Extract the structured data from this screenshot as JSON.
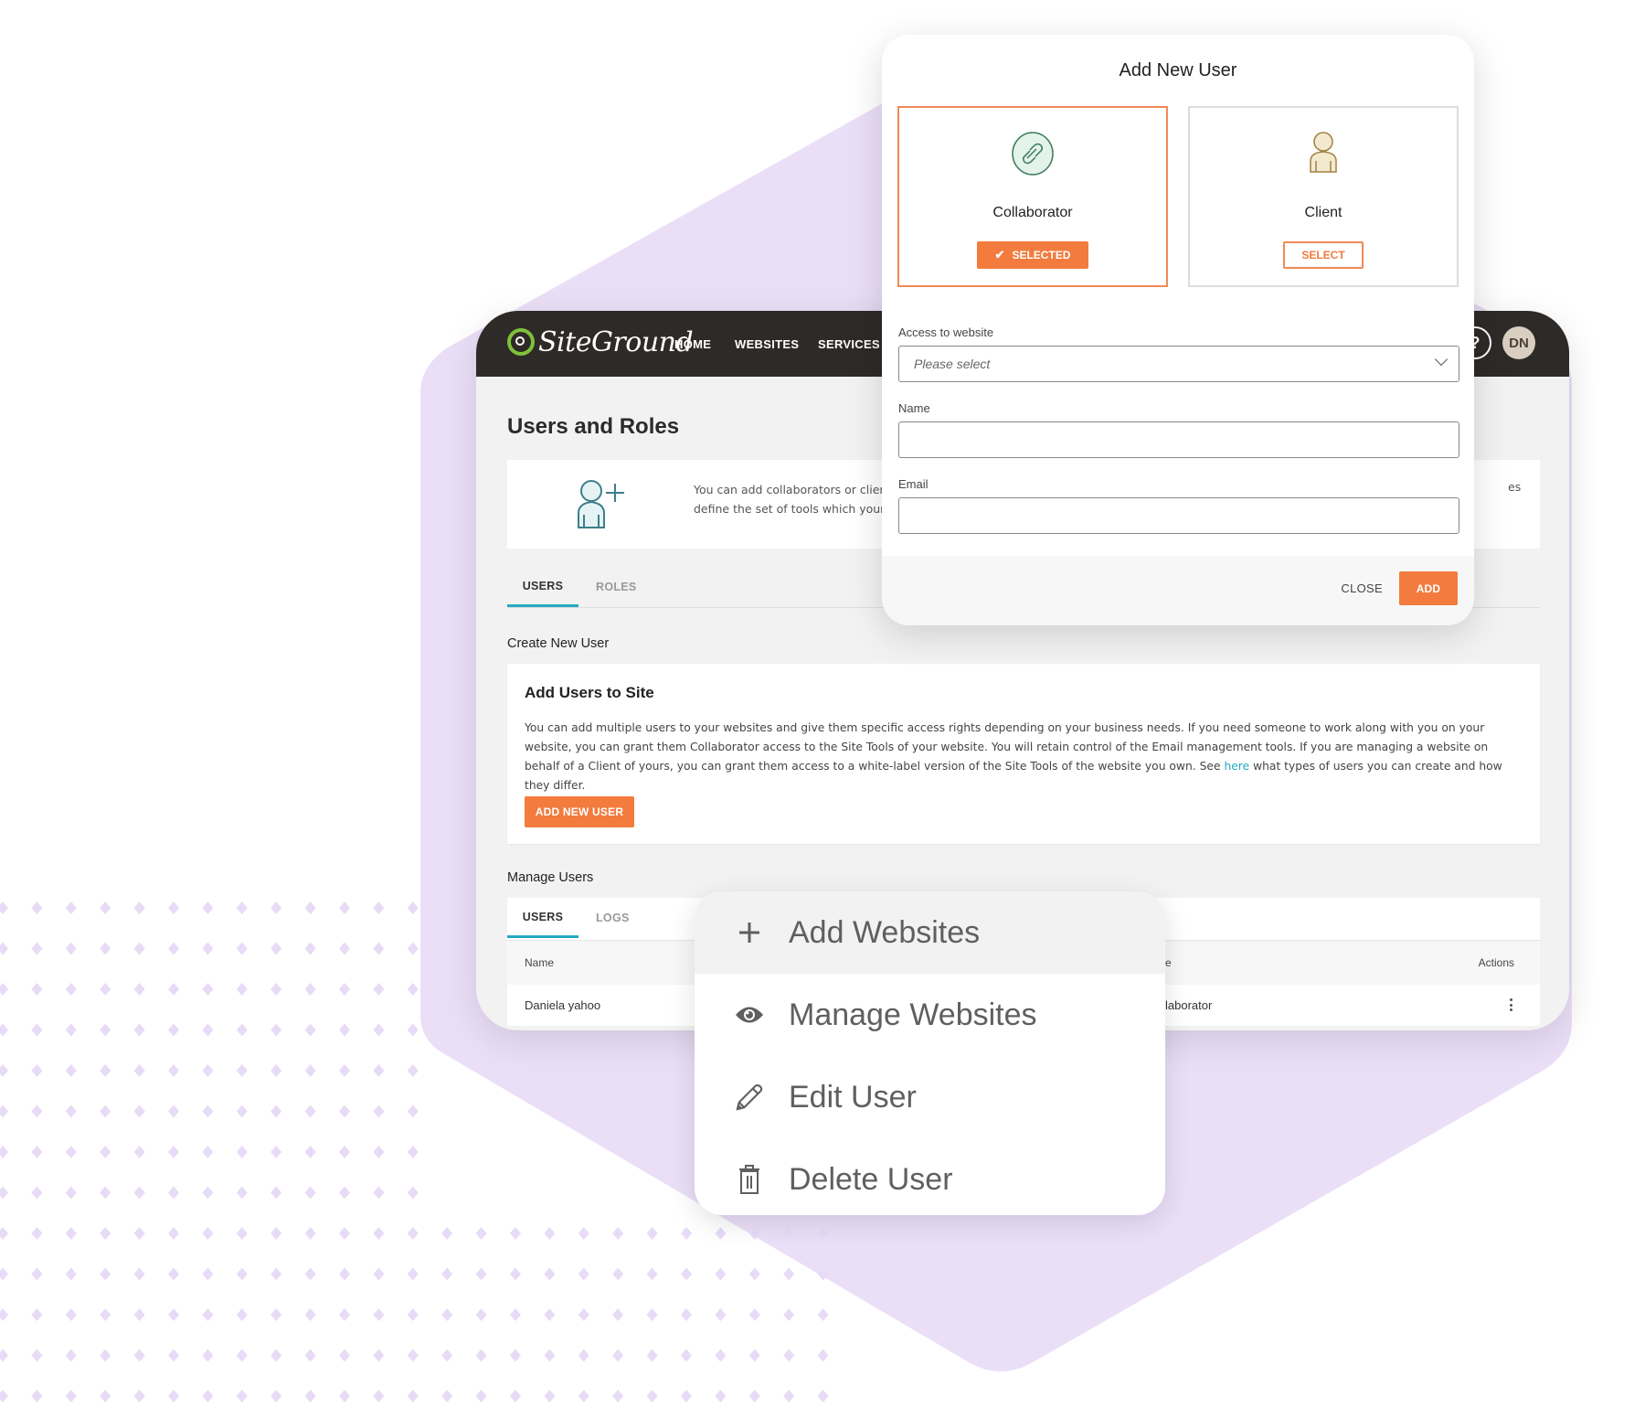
{
  "colors": {
    "accent_orange": "#f27b3d",
    "tab_underline": "#24a9c1",
    "link": "#24a9c1",
    "topbar": "#2e2a28",
    "hex_bg": "#ebdff8",
    "dots": "#e7dbf7",
    "logo_green": "#7ec13b"
  },
  "header": {
    "logo_text": "SiteGround",
    "nav": [
      "HOME",
      "WEBSITES",
      "SERVICES"
    ],
    "avatar_initials": "DN",
    "help_icon": "question-circle-icon"
  },
  "page": {
    "title": "Users and Roles",
    "info_text": "You can add collaborators or clients to your websites and define the set of tools which your users will have access to. … es",
    "info_line1": "You can add collaborators or clier",
    "info_line2": "define the set of tools which your",
    "info_tail": "es",
    "info_icon": "add-user-icon",
    "tabs": [
      {
        "label": "USERS",
        "active": true
      },
      {
        "label": "ROLES",
        "active": false
      }
    ],
    "create_section": "Create New User",
    "add_card": {
      "title": "Add Users to Site",
      "text_before_link": "You can add multiple users to your websites and give them specific access rights depending on your business needs. If you need someone to work along with you on your website, you can grant them Collaborator access to the Site Tools of your website. You will retain control of the Email management tools. If you are managing a website on behalf of a Client of yours, you can grant them access to a white-label version of the Site Tools of the website you own. See ",
      "link_text": "here",
      "text_after_link": " what types of users you can create and how they differ.",
      "button": "ADD NEW USER"
    },
    "manage_section": "Manage Users",
    "manage_tabs": [
      {
        "label": "USERS",
        "active": true
      },
      {
        "label": "LOGS",
        "active": false
      }
    ],
    "table": {
      "columns": [
        "Name",
        "Role",
        "Actions"
      ],
      "visible_column_fragments": {
        "role": "e"
      },
      "rows": [
        {
          "name": "Daniela yahoo",
          "role_fragment": "laborator",
          "role": "Collaborator"
        }
      ]
    }
  },
  "modal": {
    "title": "Add New User",
    "roles": [
      {
        "name": "Collaborator",
        "icon": "link-icon",
        "button": "SELECTED",
        "selected": true
      },
      {
        "name": "Client",
        "icon": "person-icon",
        "button": "SELECT",
        "selected": false
      }
    ],
    "fields": [
      {
        "label": "Access to website",
        "type": "select",
        "placeholder": "Please select",
        "value": ""
      },
      {
        "label": "Name",
        "type": "text",
        "placeholder": "",
        "value": ""
      },
      {
        "label": "Email",
        "type": "text",
        "placeholder": "",
        "value": ""
      }
    ],
    "close": "CLOSE",
    "add": "ADD"
  },
  "context_menu": {
    "items": [
      {
        "label": "Add Websites",
        "icon": "plus-icon",
        "highlighted": true
      },
      {
        "label": "Manage Websites",
        "icon": "eye-icon",
        "highlighted": false
      },
      {
        "label": "Edit User",
        "icon": "pencil-icon",
        "highlighted": false
      },
      {
        "label": "Delete User",
        "icon": "trash-icon",
        "highlighted": false
      }
    ]
  }
}
